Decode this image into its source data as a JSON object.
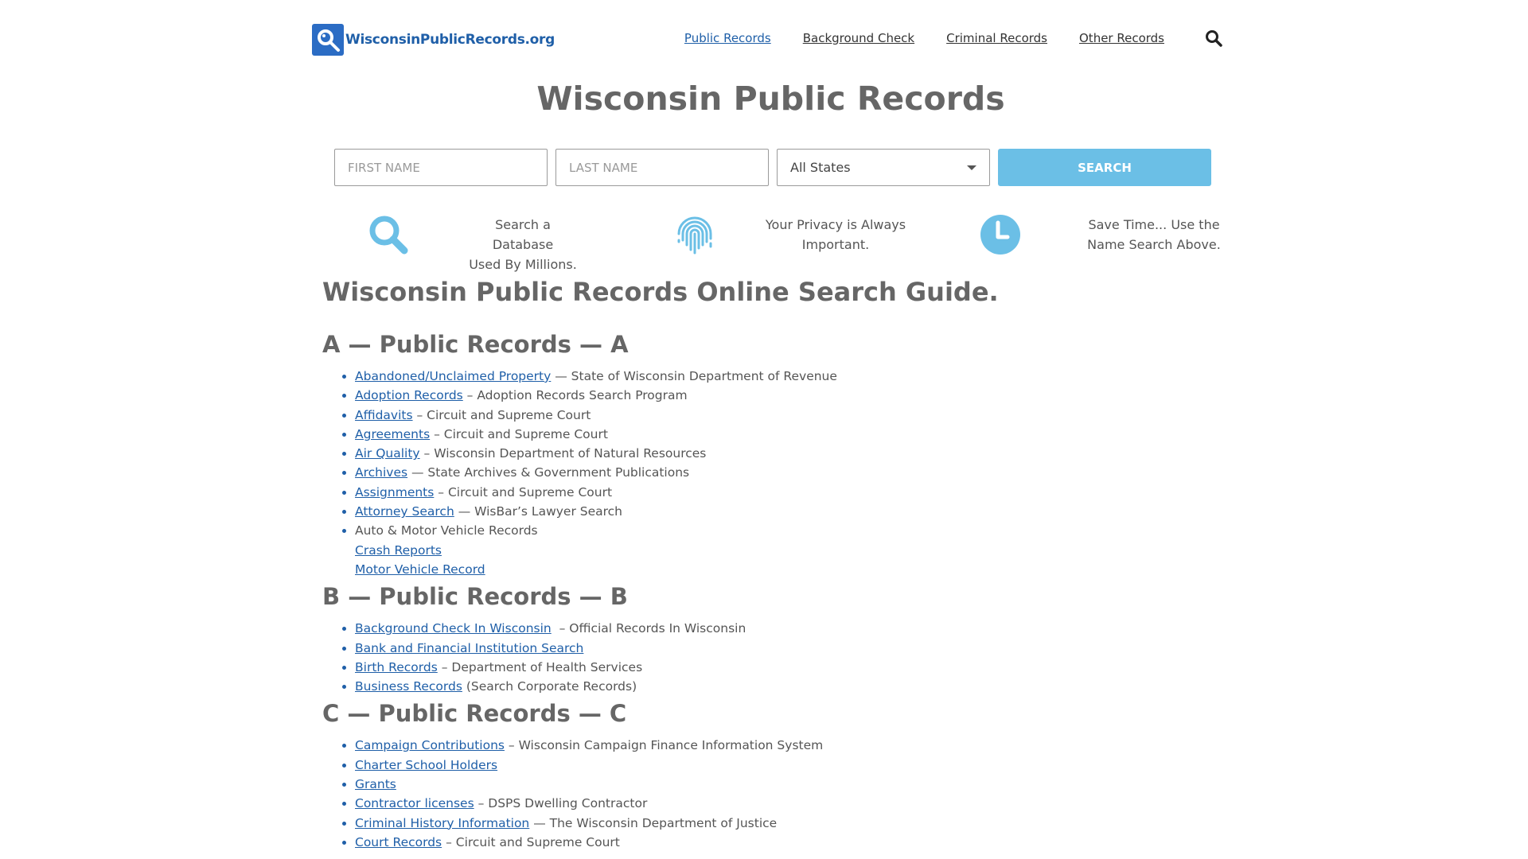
{
  "header": {
    "logo_text": "WisconsinPublicRecords.org",
    "nav": [
      {
        "label": "Public Records",
        "active": true
      },
      {
        "label": "Background Check",
        "active": false
      },
      {
        "label": "Criminal Records",
        "active": false
      },
      {
        "label": "Other Records",
        "active": false
      }
    ],
    "search_icon": "search-icon"
  },
  "page_title": "Wisconsin Public Records",
  "search_form": {
    "first_name_placeholder": "FIRST NAME",
    "last_name_placeholder": "LAST NAME",
    "state_selected": "All States",
    "submit_label": "SEARCH"
  },
  "features": [
    {
      "icon": "magnifier-icon",
      "line1": "Search a Database",
      "line2": "Used By Millions."
    },
    {
      "icon": "fingerprint-icon",
      "line1": "Your Privacy is Always",
      "line2": "Important."
    },
    {
      "icon": "clock-icon",
      "line1": "Save Time... Use the",
      "line2": "Name Search Above."
    }
  ],
  "guide_title": "Wisconsin Public Records Online Search Guide.",
  "sections": [
    {
      "title": "A — Public Records — A",
      "items": [
        {
          "link": "Abandoned/Unclaimed Property",
          "desc": " — State of Wisconsin Department of Revenue"
        },
        {
          "link": "Adoption Records",
          "desc": " – Adoption Records Search Program"
        },
        {
          "link": "Affidavits",
          "desc": " – Circuit and Supreme Court"
        },
        {
          "link": "Agreements",
          "desc": " – Circuit and Supreme Court"
        },
        {
          "link": "Air Quality",
          "desc": " – Wisconsin Department of Natural Resources"
        },
        {
          "link": "Archives",
          "desc": " — State Archives & Government Publications"
        },
        {
          "link": "Assignments",
          "desc": " – Circuit and Supreme Court"
        },
        {
          "link": "Attorney Search",
          "desc": " — WisBar’s Lawyer Search"
        },
        {
          "text": "Auto & Motor Vehicle Records",
          "sublinks": [
            "Crash Reports",
            "Motor Vehicle Record"
          ]
        }
      ]
    },
    {
      "title": "B — Public Records — B",
      "items": [
        {
          "link": "Background Check In Wisconsin",
          "desc": "  – Official Records In Wisconsin"
        },
        {
          "link": "Bank and Financial Institution Search",
          "desc": ""
        },
        {
          "link": "Birth Records",
          "desc": " – Department of Health Services"
        },
        {
          "link": "Business Records",
          "desc": " (Search Corporate Records)"
        }
      ]
    },
    {
      "title": "C — Public Records — C",
      "items": [
        {
          "link": "Campaign Contributions",
          "desc": " – Wisconsin Campaign Finance Information System"
        },
        {
          "link": "Charter School Holders",
          "desc": ""
        },
        {
          "link": "Grants",
          "desc": ""
        },
        {
          "link": "Contractor licenses",
          "desc": " – DSPS Dwelling Contractor"
        },
        {
          "link": "Criminal History Information",
          "desc": " — The Wisconsin Department of Justice"
        },
        {
          "link": "Court Records",
          "desc": " – Circuit and Supreme Court"
        }
      ]
    }
  ],
  "colors": {
    "accent": "#6bbfe6",
    "link": "#1f5fa8",
    "heading": "#666666",
    "logo_blue": "#2b6cc4"
  }
}
